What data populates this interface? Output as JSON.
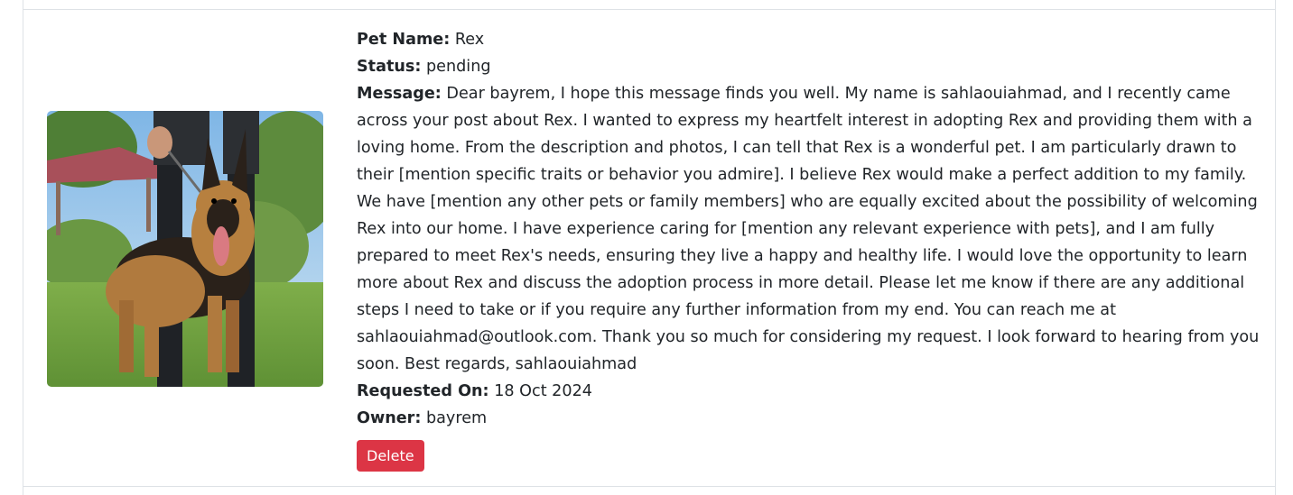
{
  "request": {
    "pet_name_label": "Pet Name:",
    "pet_name": "Rex",
    "status_label": "Status:",
    "status": "pending",
    "message_label": "Message:",
    "message": "Dear bayrem, I hope this message finds you well. My name is sahlaouiahmad, and I recently came across your post about Rex. I wanted to express my heartfelt interest in adopting Rex and providing them with a loving home. From the description and photos, I can tell that Rex is a wonderful pet. I am particularly drawn to their [mention specific traits or behavior you admire]. I believe Rex would make a perfect addition to my family. We have [mention any other pets or family members] who are equally excited about the possibility of welcoming Rex into our home. I have experience caring for [mention any relevant experience with pets], and I am fully prepared to meet Rex's needs, ensuring they live a happy and healthy life. I would love the opportunity to learn more about Rex and discuss the adoption process in more detail. Please let me know if there are any additional steps I need to take or if you require any further information from my end. You can reach me at sahlaouiahmad@outlook.com. Thank you so much for considering my request. I look forward to hearing from you soon. Best regards, sahlaouiahmad",
    "requested_on_label": "Requested On:",
    "requested_on": "18 Oct 2024",
    "owner_label": "Owner:",
    "owner": "bayrem",
    "delete_label": "Delete"
  },
  "colors": {
    "danger": "#dc3545",
    "text": "#212529",
    "border": "#dee2e6"
  }
}
